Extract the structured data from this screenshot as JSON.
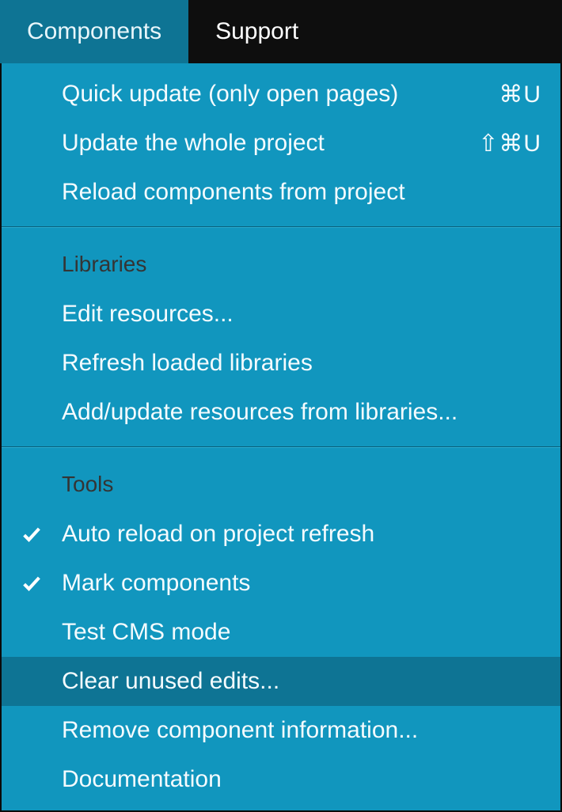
{
  "menubar": {
    "items": [
      {
        "label": "Components",
        "active": true
      },
      {
        "label": "Support",
        "active": false
      }
    ]
  },
  "dropdown": {
    "sections": [
      {
        "header": null,
        "items": [
          {
            "label": "Quick update (only open pages)",
            "shortcut": "⌘U",
            "checked": false,
            "hovered": false
          },
          {
            "label": "Update the whole project",
            "shortcut": "⇧⌘U",
            "checked": false,
            "hovered": false
          },
          {
            "label": "Reload components from project",
            "shortcut": "",
            "checked": false,
            "hovered": false
          }
        ]
      },
      {
        "header": "Libraries",
        "items": [
          {
            "label": "Edit resources...",
            "shortcut": "",
            "checked": false,
            "hovered": false
          },
          {
            "label": "Refresh loaded libraries",
            "shortcut": "",
            "checked": false,
            "hovered": false
          },
          {
            "label": "Add/update resources from libraries...",
            "shortcut": "",
            "checked": false,
            "hovered": false
          }
        ]
      },
      {
        "header": "Tools",
        "items": [
          {
            "label": "Auto reload on project refresh",
            "shortcut": "",
            "checked": true,
            "hovered": false
          },
          {
            "label": "Mark components",
            "shortcut": "",
            "checked": true,
            "hovered": false
          },
          {
            "label": "Test CMS mode",
            "shortcut": "",
            "checked": false,
            "hovered": false
          },
          {
            "label": "Clear unused edits...",
            "shortcut": "",
            "checked": false,
            "hovered": true
          },
          {
            "label": "Remove component information...",
            "shortcut": "",
            "checked": false,
            "hovered": false
          },
          {
            "label": "Documentation",
            "shortcut": "",
            "checked": false,
            "hovered": false
          }
        ]
      }
    ]
  }
}
